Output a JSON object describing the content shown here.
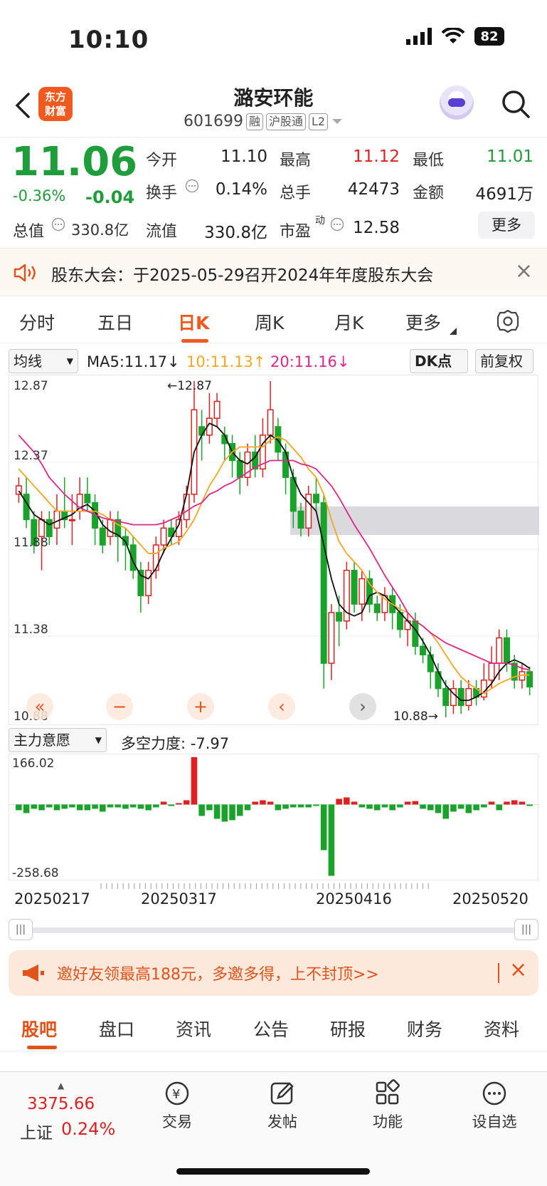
{
  "status": {
    "time": "10:10",
    "battery": "82"
  },
  "header": {
    "logo": "东方\n财富",
    "title": "潞安环能",
    "code": "601699",
    "tags": [
      "融",
      "沪股通",
      "L2"
    ]
  },
  "quote": {
    "price": "11.06",
    "change_pct": "-0.36%",
    "change": "-0.04",
    "fields": [
      {
        "label": "今开",
        "value": "11.10",
        "color": "#222"
      },
      {
        "label": "最高",
        "value": "11.12",
        "color": "#e02020"
      },
      {
        "label": "最低",
        "value": "11.01",
        "color": "#1f9d3a"
      },
      {
        "label": "换手",
        "value": "0.14%",
        "color": "#222"
      },
      {
        "label": "总手",
        "value": "42473",
        "color": "#222"
      },
      {
        "label": "金额",
        "value": "4691万",
        "color": "#222"
      },
      {
        "label": "总值",
        "value": "330.8亿",
        "color": "#222"
      },
      {
        "label": "流值",
        "value": "330.8亿",
        "color": "#222"
      },
      {
        "label": "市盈",
        "value": "12.58",
        "color": "#222"
      }
    ],
    "pe_sup": "动",
    "more": "更多"
  },
  "notice": {
    "text": "股东大会：于2025-05-29召开2024年年度股东大会"
  },
  "tabs": [
    "分时",
    "五日",
    "日K",
    "周K",
    "月K",
    "更多"
  ],
  "active_tab": "日K",
  "ma": {
    "dropdown": "均线",
    "ma5": "MA5:11.17↓",
    "ma10": "10:11.13↑",
    "ma20": "20:11.16↓",
    "dk": "DK点",
    "fq": "前复权"
  },
  "chart_data": {
    "type": "candlestick",
    "y_ticks": [
      "12.87",
      "12.37",
      "11.88",
      "11.38",
      "10.88"
    ],
    "ylim": [
      10.88,
      12.87
    ],
    "high_label": "←12.87",
    "low_label": "10.88→",
    "candles": [
      [
        12.2,
        12.25,
        12.3,
        12.15
      ],
      [
        12.2,
        12.05,
        12.3,
        12.0
      ],
      [
        12.05,
        11.9,
        12.1,
        11.85
      ],
      [
        11.95,
        12.05,
        12.1,
        11.75
      ],
      [
        12.05,
        11.95,
        12.1,
        11.9
      ],
      [
        12.0,
        12.1,
        12.2,
        11.9
      ],
      [
        12.1,
        12.05,
        12.3,
        12.0
      ],
      [
        12.05,
        12.05,
        12.2,
        11.9
      ],
      [
        12.1,
        12.2,
        12.3,
        12.05
      ],
      [
        12.2,
        12.15,
        12.3,
        12.1
      ],
      [
        12.15,
        12.0,
        12.2,
        11.9
      ],
      [
        12.0,
        11.9,
        12.05,
        11.85
      ],
      [
        11.95,
        12.05,
        12.1,
        11.9
      ],
      [
        12.05,
        11.95,
        12.1,
        11.8
      ],
      [
        11.95,
        11.9,
        12.0,
        11.75
      ],
      [
        11.9,
        11.75,
        11.95,
        11.7
      ],
      [
        11.75,
        11.6,
        11.8,
        11.5
      ],
      [
        11.6,
        11.75,
        11.8,
        11.55
      ],
      [
        11.75,
        11.9,
        11.95,
        11.7
      ],
      [
        11.9,
        12.0,
        12.05,
        11.85
      ],
      [
        12.0,
        11.95,
        12.05,
        11.9
      ],
      [
        11.95,
        12.05,
        12.1,
        11.9
      ],
      [
        12.05,
        12.2,
        12.25,
        12.0
      ],
      [
        12.2,
        12.7,
        12.87,
        12.15
      ],
      [
        12.6,
        12.55,
        12.7,
        12.4
      ],
      [
        12.55,
        12.65,
        12.8,
        12.5
      ],
      [
        12.65,
        12.75,
        12.8,
        12.6
      ],
      [
        12.55,
        12.5,
        12.6,
        12.4
      ],
      [
        12.5,
        12.4,
        12.55,
        12.3
      ],
      [
        12.4,
        12.3,
        12.45,
        12.2
      ],
      [
        12.3,
        12.45,
        12.5,
        12.25
      ],
      [
        12.45,
        12.35,
        12.55,
        12.3
      ],
      [
        12.35,
        12.55,
        12.65,
        12.3
      ],
      [
        12.55,
        12.7,
        12.87,
        12.5
      ],
      [
        12.6,
        12.45,
        12.65,
        12.4
      ],
      [
        12.45,
        12.3,
        12.5,
        12.2
      ],
      [
        12.3,
        12.1,
        12.35,
        12.0
      ],
      [
        12.1,
        12.0,
        12.15,
        11.95
      ],
      [
        12.0,
        12.2,
        12.25,
        11.95
      ],
      [
        12.2,
        12.15,
        12.3,
        12.1
      ],
      [
        12.15,
        11.2,
        12.2,
        11.05
      ],
      [
        11.2,
        11.5,
        11.55,
        11.1
      ],
      [
        11.5,
        11.45,
        11.6,
        11.3
      ],
      [
        11.45,
        11.75,
        11.8,
        11.4
      ],
      [
        11.75,
        11.55,
        11.8,
        11.5
      ],
      [
        11.55,
        11.7,
        11.75,
        11.45
      ],
      [
        11.7,
        11.55,
        11.75,
        11.5
      ],
      [
        11.55,
        11.5,
        11.6,
        11.45
      ],
      [
        11.5,
        11.6,
        11.65,
        11.45
      ],
      [
        11.6,
        11.5,
        11.65,
        11.4
      ],
      [
        11.5,
        11.4,
        11.55,
        11.35
      ],
      [
        11.4,
        11.45,
        11.5,
        11.3
      ],
      [
        11.45,
        11.3,
        11.5,
        11.25
      ],
      [
        11.3,
        11.25,
        11.35,
        11.2
      ],
      [
        11.25,
        11.15,
        11.3,
        11.05
      ],
      [
        11.15,
        11.05,
        11.2,
        11.0
      ],
      [
        11.05,
        10.95,
        11.1,
        10.88
      ],
      [
        10.95,
        11.05,
        11.1,
        10.9
      ],
      [
        11.05,
        10.95,
        11.1,
        10.9
      ],
      [
        10.95,
        11.05,
        11.1,
        10.92
      ],
      [
        11.05,
        11.0,
        11.1,
        10.95
      ],
      [
        11.0,
        11.1,
        11.2,
        10.98
      ],
      [
        11.1,
        11.2,
        11.3,
        11.05
      ],
      [
        11.2,
        11.35,
        11.4,
        11.1
      ],
      [
        11.35,
        11.2,
        11.4,
        11.15
      ],
      [
        11.2,
        11.1,
        11.25,
        11.05
      ],
      [
        11.1,
        11.15,
        11.2,
        11.05
      ],
      [
        11.15,
        11.06,
        11.18,
        11.01
      ]
    ],
    "ma5": [
      12.22,
      12.15,
      12.08,
      12.05,
      12.02,
      12.04,
      12.06,
      12.08,
      12.12,
      12.14,
      12.1,
      12.02,
      11.98,
      11.96,
      11.92,
      11.8,
      11.72,
      11.7,
      11.76,
      11.86,
      11.94,
      12.02,
      12.2,
      12.45,
      12.55,
      12.62,
      12.6,
      12.55,
      12.45,
      12.4,
      12.38,
      12.42,
      12.5,
      12.55,
      12.52,
      12.45,
      12.3,
      12.2,
      12.15,
      12.1,
      11.9,
      11.7,
      11.55,
      11.5,
      11.48,
      11.5,
      11.6,
      11.62,
      11.6,
      11.55,
      11.5,
      11.45,
      11.4,
      11.33,
      11.25,
      11.15,
      11.07,
      11.02,
      10.98,
      10.98,
      11.0,
      11.03,
      11.08,
      11.15,
      11.2,
      11.22,
      11.2,
      11.17
    ],
    "ma10": [
      12.35,
      12.3,
      12.25,
      12.2,
      12.15,
      12.1,
      12.1,
      12.1,
      12.1,
      12.1,
      12.1,
      12.08,
      12.05,
      12.02,
      12.0,
      11.95,
      11.9,
      11.85,
      11.85,
      11.88,
      11.9,
      11.92,
      11.98,
      12.05,
      12.15,
      12.25,
      12.32,
      12.4,
      12.45,
      12.48,
      12.48,
      12.48,
      12.48,
      12.52,
      12.54,
      12.52,
      12.47,
      12.42,
      12.35,
      12.3,
      12.2,
      12.05,
      11.92,
      11.85,
      11.8,
      11.75,
      11.67,
      11.62,
      11.58,
      11.55,
      11.52,
      11.5,
      11.45,
      11.42,
      11.38,
      11.32,
      11.25,
      11.18,
      11.12,
      11.08,
      11.05,
      11.02,
      11.05,
      11.08,
      11.1,
      11.12,
      11.13,
      11.13
    ],
    "ma20": [
      12.55,
      12.5,
      12.45,
      12.38,
      12.3,
      12.25,
      12.2,
      12.16,
      12.12,
      12.1,
      12.08,
      12.06,
      12.05,
      12.04,
      12.03,
      12.02,
      12.02,
      12.02,
      12.02,
      12.03,
      12.05,
      12.07,
      12.1,
      12.13,
      12.15,
      12.2,
      12.22,
      12.25,
      12.27,
      12.3,
      12.33,
      12.36,
      12.38,
      12.4,
      12.4,
      12.4,
      12.4,
      12.38,
      12.37,
      12.35,
      12.3,
      12.25,
      12.18,
      12.1,
      12.02,
      11.95,
      11.88,
      11.8,
      11.72,
      11.65,
      11.58,
      11.5,
      11.45,
      11.42,
      11.38,
      11.35,
      11.32,
      11.3,
      11.28,
      11.26,
      11.24,
      11.22,
      11.2,
      11.2,
      11.2,
      11.19,
      11.17,
      11.16
    ]
  },
  "chart_controls": [
    "«",
    "−",
    "+",
    "‹",
    "›"
  ],
  "sub": {
    "dropdown": "主力意愿",
    "label": "多空力度: -7.97",
    "max": "166.02",
    "min": "-258.68"
  },
  "volume": [
    -20,
    -30,
    -15,
    -20,
    -10,
    -20,
    -15,
    -10,
    -20,
    -20,
    -15,
    -25,
    -10,
    -10,
    -15,
    -10,
    -15,
    -20,
    -10,
    10,
    -5,
    5,
    15,
    166,
    -40,
    -20,
    -50,
    -60,
    -55,
    -40,
    -20,
    10,
    15,
    10,
    -20,
    -15,
    -10,
    -10,
    -10,
    -5,
    -160,
    -250,
    20,
    25,
    10,
    -10,
    -15,
    -20,
    -10,
    -20,
    -10,
    10,
    12,
    -15,
    -20,
    -30,
    -50,
    -25,
    -15,
    -30,
    -20,
    -10,
    10,
    -20,
    10,
    15,
    10,
    -5
  ],
  "dates": [
    "20250217",
    "20250317",
    "20250416",
    "20250520"
  ],
  "banner": {
    "text": "邀好友领最高188元，多邀多得，上不封顶>>"
  },
  "btabs": [
    "股吧",
    "盘口",
    "资讯",
    "公告",
    "研报",
    "财务",
    "资料"
  ],
  "bottom": {
    "index_value": "3375.66",
    "index_name": "上证",
    "index_pct": "0.24%",
    "items": [
      "交易",
      "发帖",
      "功能",
      "设自选"
    ]
  }
}
